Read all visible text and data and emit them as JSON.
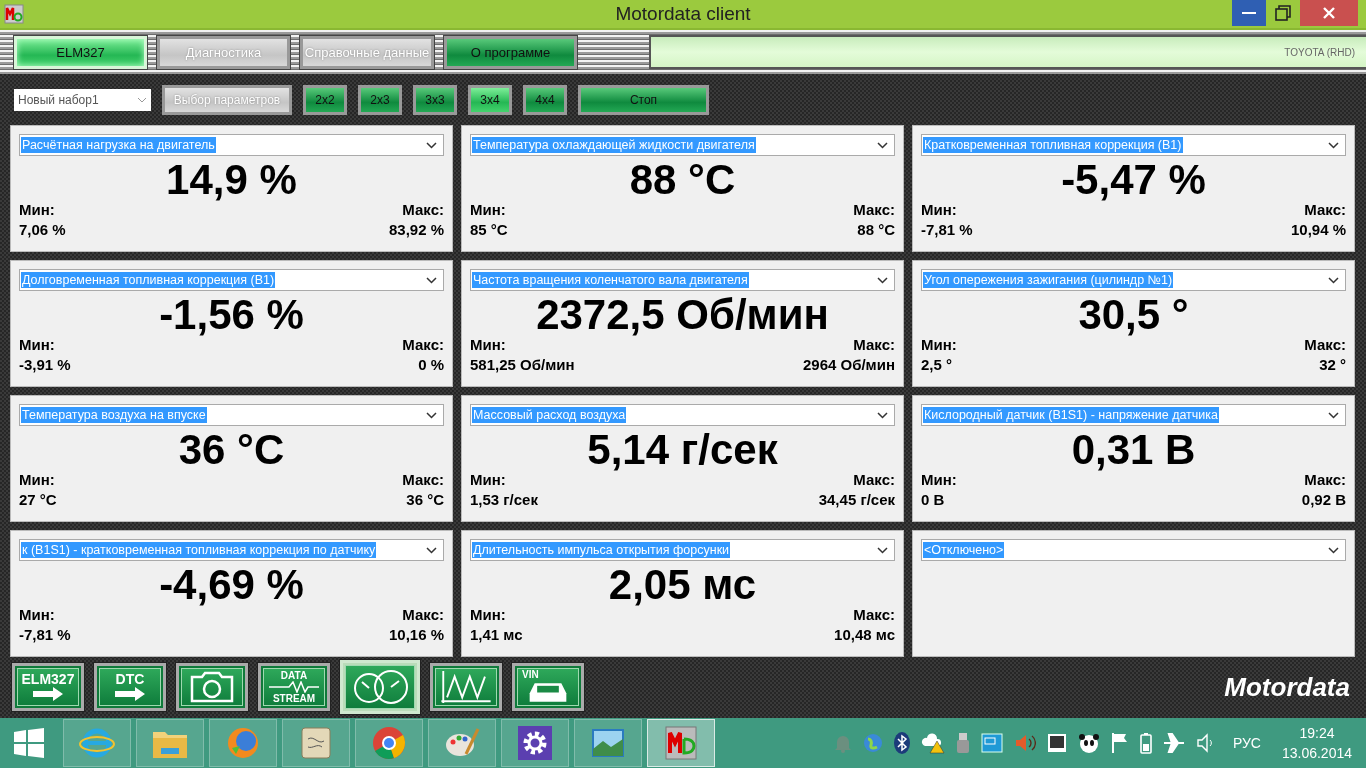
{
  "window": {
    "title": "Motordata client"
  },
  "menu": [
    {
      "label": "ELM327",
      "selected": true,
      "disabled": false
    },
    {
      "label": "Диагностика",
      "selected": false,
      "disabled": true
    },
    {
      "label": "Справочные данные",
      "selected": false,
      "disabled": true
    },
    {
      "label": "О программе",
      "selected": false,
      "disabled": false
    }
  ],
  "vehicle": "TOYOTA (RHD)",
  "toolbar": {
    "set_select": {
      "value": "Новый набор1"
    },
    "param_button": {
      "label": "Выбор параметров",
      "disabled": true
    },
    "layouts": [
      {
        "label": "2x2",
        "selected": false
      },
      {
        "label": "2x3",
        "selected": false
      },
      {
        "label": "3x3",
        "selected": false
      },
      {
        "label": "3x4",
        "selected": true
      },
      {
        "label": "4x4",
        "selected": false
      }
    ],
    "stop_button": {
      "label": "Стоп"
    }
  },
  "gauges": [
    {
      "kind": "reading",
      "parameter": "Расчётная нагрузка на двигатель",
      "value": "14,9 %",
      "min_label": "Мин:",
      "min": "7,06 %",
      "max_label": "Макс:",
      "max": "83,92 %"
    },
    {
      "kind": "reading",
      "parameter": "Температура охлаждающей жидкости двигателя",
      "value": "88 °C",
      "min_label": "Мин:",
      "min": "85 °C",
      "max_label": "Макс:",
      "max": "88 °C"
    },
    {
      "kind": "reading",
      "parameter": "Кратковременная топливная коррекция (B1)",
      "value": "-5,47 %",
      "min_label": "Мин:",
      "min": "-7,81 %",
      "max_label": "Макс:",
      "max": "10,94 %"
    },
    {
      "kind": "reading",
      "parameter": "Долговременная топливная коррекция (B1)",
      "value": "-1,56 %",
      "min_label": "Мин:",
      "min": "-3,91 %",
      "max_label": "Макс:",
      "max": "0 %"
    },
    {
      "kind": "reading",
      "parameter": "Частота вращения коленчатого вала двигателя",
      "value": "2372,5 Об/мин",
      "min_label": "Мин:",
      "min": "581,25 Об/мин",
      "max_label": "Макс:",
      "max": "2964 Об/мин"
    },
    {
      "kind": "reading",
      "parameter": "Угол опережения зажигания (цилиндр №1)",
      "value": "30,5 °",
      "min_label": "Мин:",
      "min": "2,5 °",
      "max_label": "Макс:",
      "max": "32 °"
    },
    {
      "kind": "reading",
      "parameter": "Температура воздуха на впуске",
      "value": "36 °C",
      "min_label": "Мин:",
      "min": "27 °C",
      "max_label": "Макс:",
      "max": "36 °C"
    },
    {
      "kind": "reading",
      "parameter": "Массовый расход воздуха",
      "value": "5,14 г/сек",
      "min_label": "Мин:",
      "min": "1,53 г/сек",
      "max_label": "Макс:",
      "max": "34,45 г/сек"
    },
    {
      "kind": "reading",
      "parameter": "Кислородный датчик (B1S1) - напряжение датчика",
      "value": "0,31 В",
      "min_label": "Мин:",
      "min": "0 В",
      "max_label": "Макс:",
      "max": "0,92 В"
    },
    {
      "kind": "reading",
      "parameter": "к (B1S1) - кратковременная топливная коррекция по датчику",
      "value": "-4,69 %",
      "min_label": "Мин:",
      "min": "-7,81 %",
      "max_label": "Макс:",
      "max": "10,16 %"
    },
    {
      "kind": "reading",
      "parameter": "Длительность импульса открытия форсунки",
      "value": "2,05 мс",
      "min_label": "Мин:",
      "min": "1,41 мс",
      "max_label": "Макс:",
      "max": "10,48 мс"
    },
    {
      "kind": "off",
      "parameter": "<Отключено>"
    }
  ],
  "tools": [
    {
      "kind": "elm",
      "label": "ELM327",
      "selected": false
    },
    {
      "kind": "dtc",
      "label": "DTC",
      "selected": false
    },
    {
      "kind": "camera",
      "selected": false
    },
    {
      "kind": "stream",
      "label": "DATA",
      "label2": "STREAM",
      "selected": false
    },
    {
      "kind": "gauges",
      "selected": true
    },
    {
      "kind": "graph",
      "selected": false
    },
    {
      "kind": "vin",
      "label": "VIN",
      "selected": false
    }
  ],
  "brand": "Motordata",
  "taskbar": {
    "apps": [
      {
        "kind": "browser",
        "selected": false
      },
      {
        "kind": "folder",
        "selected": false
      },
      {
        "kind": "media",
        "selected": false
      },
      {
        "kind": "notes",
        "selected": false
      },
      {
        "kind": "chrome",
        "selected": false
      },
      {
        "kind": "paint",
        "selected": false
      },
      {
        "kind": "settings",
        "selected": false
      },
      {
        "kind": "photos",
        "selected": false
      },
      {
        "kind": "motordata",
        "selected": true
      }
    ],
    "language": "РУС",
    "time": "19:24",
    "date": "13.06.2014"
  }
}
